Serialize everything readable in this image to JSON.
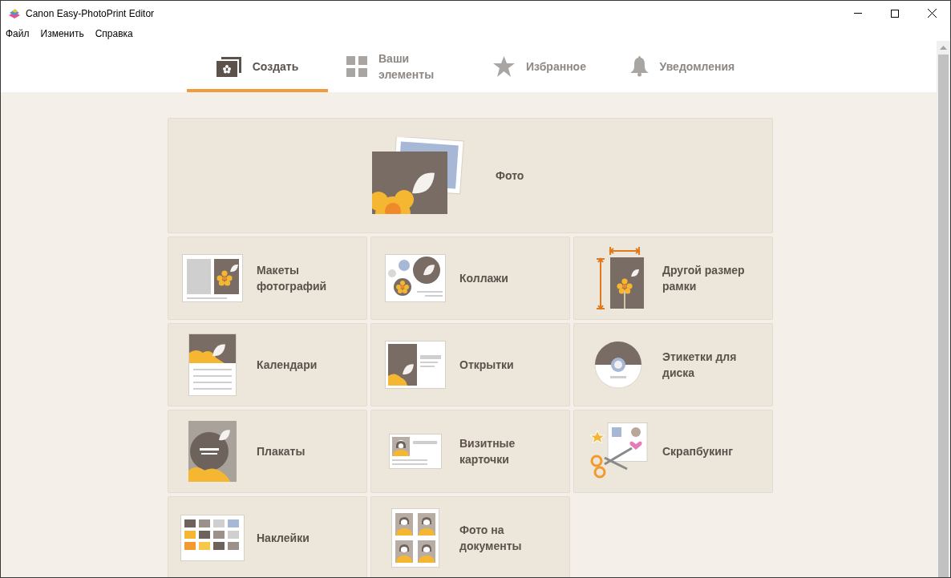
{
  "window": {
    "title": "Canon Easy-PhotoPrint Editor"
  },
  "menu": [
    "Файл",
    "Изменить",
    "Справка"
  ],
  "tabs": [
    {
      "kind": "create",
      "label": "Создать",
      "selected": true
    },
    {
      "kind": "items",
      "label": "Ваши элементы",
      "selected": false
    },
    {
      "kind": "favorites",
      "label": "Избранное",
      "selected": false
    },
    {
      "kind": "notifications",
      "label": "Уведомления",
      "selected": false
    }
  ],
  "featured": {
    "kind": "photo",
    "label": "Фото"
  },
  "cards": [
    {
      "kind": "layouts",
      "label": "Макеты фотографий"
    },
    {
      "kind": "collage",
      "label": "Коллажи"
    },
    {
      "kind": "size",
      "label": "Другой размер рамки"
    },
    {
      "kind": "calendar",
      "label": "Календари"
    },
    {
      "kind": "postcard",
      "label": "Открытки"
    },
    {
      "kind": "disc",
      "label": "Этикетки для диска"
    },
    {
      "kind": "poster",
      "label": "Плакаты"
    },
    {
      "kind": "business",
      "label": "Визитные карточки"
    },
    {
      "kind": "scrapbook",
      "label": "Скрапбукинг"
    },
    {
      "kind": "stickers",
      "label": "Наклейки"
    },
    {
      "kind": "id",
      "label": "Фото на документы"
    }
  ]
}
